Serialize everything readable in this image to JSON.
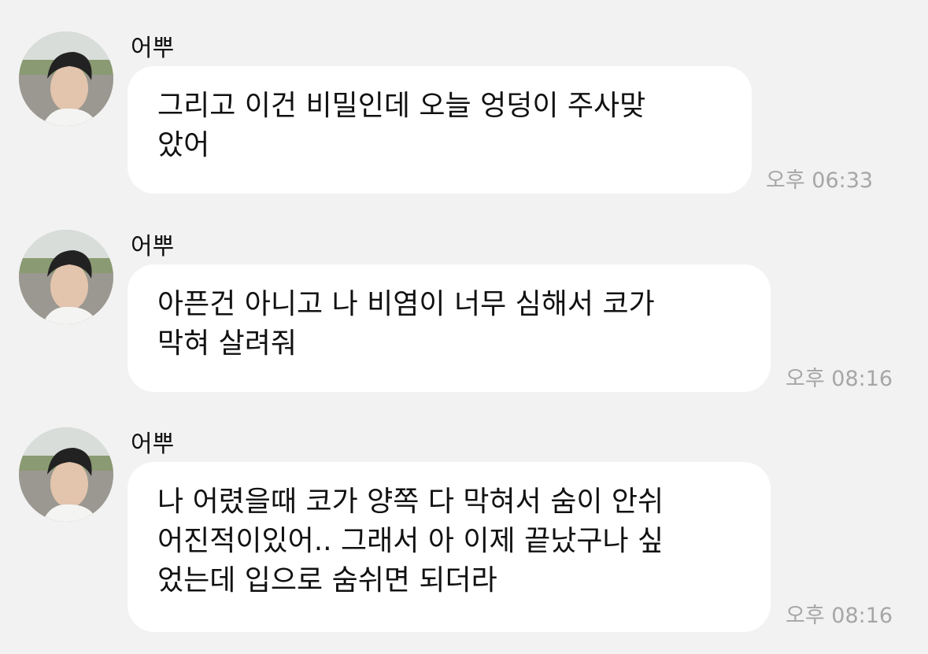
{
  "messages": [
    {
      "sender": "어뿌",
      "text": "그리고 이건 비밀인데 오늘 엉덩이 주사맞\n았어",
      "time": "오후 06:33"
    },
    {
      "sender": "어뿌",
      "text": "아픈건 아니고 나 비염이 너무 심해서 코가\n막혀 살려줘",
      "time": "오후 08:16"
    },
    {
      "sender": "어뿌",
      "text": "나 어렸을때 코가 양쪽 다 막혀서 숨이 안쉬\n어진적이있어.. 그래서 아 이제 끝났구나 싶\n었는데 입으로 숨쉬면 되더라",
      "time": "오후 08:16"
    }
  ]
}
